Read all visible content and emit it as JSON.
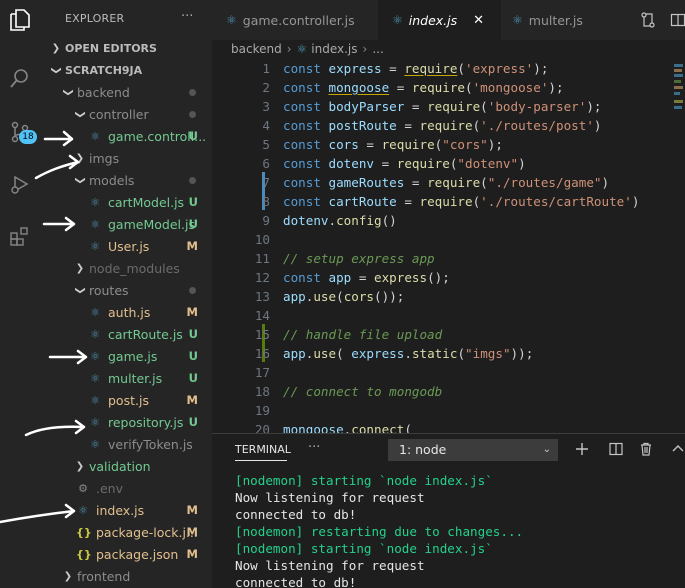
{
  "activity": {
    "scm_badge": "18"
  },
  "explorer": {
    "title": "EXPLORER",
    "more": "···",
    "open_editors": "OPEN EDITORS",
    "workspace": "SCRATCH9JA",
    "items": [
      {
        "label": "backend",
        "kind": "folder",
        "indent": 1,
        "open": true,
        "status": "",
        "color": "gray",
        "icon": ""
      },
      {
        "label": "controller",
        "kind": "folder",
        "indent": 2,
        "open": true,
        "status": "",
        "color": "gray",
        "icon": ""
      },
      {
        "label": "game.controll...",
        "kind": "file",
        "indent": 3,
        "status": "U",
        "color": "green",
        "icon": "react"
      },
      {
        "label": "imgs",
        "kind": "folder",
        "indent": 2,
        "open": false,
        "status": "",
        "color": "gray",
        "icon": ""
      },
      {
        "label": "models",
        "kind": "folder",
        "indent": 2,
        "open": true,
        "status": "",
        "color": "gray",
        "icon": ""
      },
      {
        "label": "cartModel.js",
        "kind": "file",
        "indent": 3,
        "status": "U",
        "color": "green",
        "icon": "react"
      },
      {
        "label": "gameModel.js",
        "kind": "file",
        "indent": 3,
        "status": "U",
        "color": "green",
        "icon": "react"
      },
      {
        "label": "User.js",
        "kind": "file",
        "indent": 3,
        "status": "M",
        "color": "yellow",
        "icon": "react"
      },
      {
        "label": "node_modules",
        "kind": "folder",
        "indent": 2,
        "open": false,
        "status": "",
        "color": "dim",
        "icon": ""
      },
      {
        "label": "routes",
        "kind": "folder",
        "indent": 2,
        "open": true,
        "status": "",
        "color": "gray",
        "icon": ""
      },
      {
        "label": "auth.js",
        "kind": "file",
        "indent": 3,
        "status": "M",
        "color": "yellow",
        "icon": "react"
      },
      {
        "label": "cartRoute.js",
        "kind": "file",
        "indent": 3,
        "status": "U",
        "color": "green",
        "icon": "react"
      },
      {
        "label": "game.js",
        "kind": "file",
        "indent": 3,
        "status": "U",
        "color": "green",
        "icon": "react"
      },
      {
        "label": "multer.js",
        "kind": "file",
        "indent": 3,
        "status": "U",
        "color": "green",
        "icon": "react"
      },
      {
        "label": "post.js",
        "kind": "file",
        "indent": 3,
        "status": "M",
        "color": "yellow",
        "icon": "react"
      },
      {
        "label": "repository.js",
        "kind": "file",
        "indent": 3,
        "status": "U",
        "color": "green",
        "icon": "react"
      },
      {
        "label": "verifyToken.js",
        "kind": "file",
        "indent": 3,
        "status": "",
        "color": "gray",
        "icon": "react"
      },
      {
        "label": "validation",
        "kind": "folder",
        "indent": 2,
        "open": false,
        "status": "",
        "color": "green",
        "icon": ""
      },
      {
        "label": ".env",
        "kind": "file",
        "indent": 2,
        "status": "",
        "color": "dim",
        "icon": "gear"
      },
      {
        "label": "index.js",
        "kind": "file",
        "indent": 2,
        "status": "M",
        "color": "yellow",
        "icon": "react"
      },
      {
        "label": "package-lock.j...",
        "kind": "file",
        "indent": 2,
        "status": "M",
        "color": "yellow",
        "icon": "json"
      },
      {
        "label": "package.json",
        "kind": "file",
        "indent": 2,
        "status": "M",
        "color": "yellow",
        "icon": "json"
      },
      {
        "label": "frontend",
        "kind": "folder",
        "indent": 1,
        "open": false,
        "status": "",
        "color": "gray",
        "icon": ""
      }
    ]
  },
  "tabs": [
    {
      "label": "game.controller.js",
      "active": false
    },
    {
      "label": "index.js",
      "active": true,
      "close": "✕"
    },
    {
      "label": "multer.js",
      "active": false
    }
  ],
  "breadcrumb": {
    "folder": "backend",
    "file": "index.js",
    "rest": "..."
  },
  "editor": {
    "lines": [
      {
        "n": "1",
        "t": [
          [
            "k",
            "const "
          ],
          [
            "v",
            "express"
          ],
          [
            "p",
            " = "
          ],
          [
            "fn",
            "require"
          ],
          [
            "p",
            "("
          ],
          [
            "s",
            "'express'"
          ],
          [
            "p",
            ");"
          ]
        ]
      },
      {
        "n": "2",
        "t": [
          [
            "k",
            "const "
          ],
          [
            "v",
            "mongoose"
          ],
          [
            "p",
            " = "
          ],
          [
            "fn",
            "require"
          ],
          [
            "p",
            "("
          ],
          [
            "s",
            "'mongoose'"
          ],
          [
            "p",
            ");"
          ]
        ]
      },
      {
        "n": "3",
        "t": [
          [
            "k",
            "const "
          ],
          [
            "v",
            "bodyParser"
          ],
          [
            "p",
            " = "
          ],
          [
            "fn",
            "require"
          ],
          [
            "p",
            "("
          ],
          [
            "s",
            "'body-parser'"
          ],
          [
            "p",
            ");"
          ]
        ]
      },
      {
        "n": "4",
        "t": [
          [
            "k",
            "const "
          ],
          [
            "v",
            "postRoute"
          ],
          [
            "p",
            " = "
          ],
          [
            "fn",
            "require"
          ],
          [
            "p",
            "("
          ],
          [
            "s",
            "'./routes/post'"
          ],
          [
            "p",
            ")"
          ]
        ]
      },
      {
        "n": "5",
        "t": [
          [
            "k",
            "const "
          ],
          [
            "v",
            "cors"
          ],
          [
            "p",
            " = "
          ],
          [
            "fn",
            "require"
          ],
          [
            "p",
            "("
          ],
          [
            "s",
            "\"cors\""
          ],
          [
            "p",
            ");"
          ]
        ]
      },
      {
        "n": "6",
        "t": [
          [
            "k",
            "const "
          ],
          [
            "v",
            "dotenv"
          ],
          [
            "p",
            " = "
          ],
          [
            "fn",
            "require"
          ],
          [
            "p",
            "("
          ],
          [
            "s",
            "\"dotenv\""
          ],
          [
            "p",
            ")"
          ]
        ]
      },
      {
        "n": "7",
        "t": [
          [
            "k",
            "const "
          ],
          [
            "v",
            "gameRoutes"
          ],
          [
            "p",
            " = "
          ],
          [
            "fn",
            "require"
          ],
          [
            "p",
            "("
          ],
          [
            "s",
            "\"./routes/game\""
          ],
          [
            "p",
            ")"
          ]
        ]
      },
      {
        "n": "8",
        "t": [
          [
            "k",
            "const "
          ],
          [
            "v",
            "cartRoute"
          ],
          [
            "p",
            " = "
          ],
          [
            "fn",
            "require"
          ],
          [
            "p",
            "("
          ],
          [
            "s",
            "'./routes/cartRoute'"
          ],
          [
            "p",
            ")"
          ]
        ]
      },
      {
        "n": "9",
        "t": [
          [
            "v",
            "dotenv"
          ],
          [
            "p",
            "."
          ],
          [
            "fn",
            "config"
          ],
          [
            "p",
            "()"
          ]
        ]
      },
      {
        "n": "10",
        "t": []
      },
      {
        "n": "11",
        "t": [
          [
            "cm",
            "// setup express app"
          ]
        ]
      },
      {
        "n": "12",
        "t": [
          [
            "k",
            "const "
          ],
          [
            "v",
            "app"
          ],
          [
            "p",
            " = "
          ],
          [
            "fn",
            "express"
          ],
          [
            "p",
            "();"
          ]
        ]
      },
      {
        "n": "13",
        "t": [
          [
            "v",
            "app"
          ],
          [
            "p",
            "."
          ],
          [
            "fn",
            "use"
          ],
          [
            "p",
            "("
          ],
          [
            "fn",
            "cors"
          ],
          [
            "p",
            "());"
          ]
        ]
      },
      {
        "n": "14",
        "t": []
      },
      {
        "n": "15",
        "t": [
          [
            "cm",
            "// handle file upload"
          ]
        ]
      },
      {
        "n": "16",
        "t": [
          [
            "v",
            "app"
          ],
          [
            "p",
            "."
          ],
          [
            "fn",
            "use"
          ],
          [
            "p",
            "( "
          ],
          [
            "v",
            "express"
          ],
          [
            "p",
            "."
          ],
          [
            "fn",
            "static"
          ],
          [
            "p",
            "("
          ],
          [
            "s",
            "\"imgs\""
          ],
          [
            "p",
            "));"
          ]
        ]
      },
      {
        "n": "17",
        "t": []
      },
      {
        "n": "18",
        "t": [
          [
            "cm",
            "// connect to mongodb"
          ]
        ]
      },
      {
        "n": "19",
        "t": []
      },
      {
        "n": "20",
        "t": [
          [
            "v",
            "mongoose"
          ],
          [
            "p",
            "."
          ],
          [
            "fn",
            "connect"
          ],
          [
            "p",
            "("
          ]
        ]
      }
    ]
  },
  "terminal": {
    "tab": "TERMINAL",
    "more": "···",
    "selected": "1: node",
    "lines": [
      {
        "c": "g",
        "text": "[nodemon] starting `node index.js`"
      },
      {
        "c": "w",
        "text": "Now listening for request"
      },
      {
        "c": "w",
        "text": "connected to db!"
      },
      {
        "c": "g",
        "text": "[nodemon] restarting due to changes..."
      },
      {
        "c": "g",
        "text": "[nodemon] starting `node index.js`"
      },
      {
        "c": "w",
        "text": "Now listening for request"
      },
      {
        "c": "w",
        "text": "connected to db!"
      }
    ]
  },
  "colors": {
    "green": "#73c991",
    "yellow": "#e2c08d",
    "accent": "#4fc3f7",
    "terminal_green": "#23d18b"
  }
}
